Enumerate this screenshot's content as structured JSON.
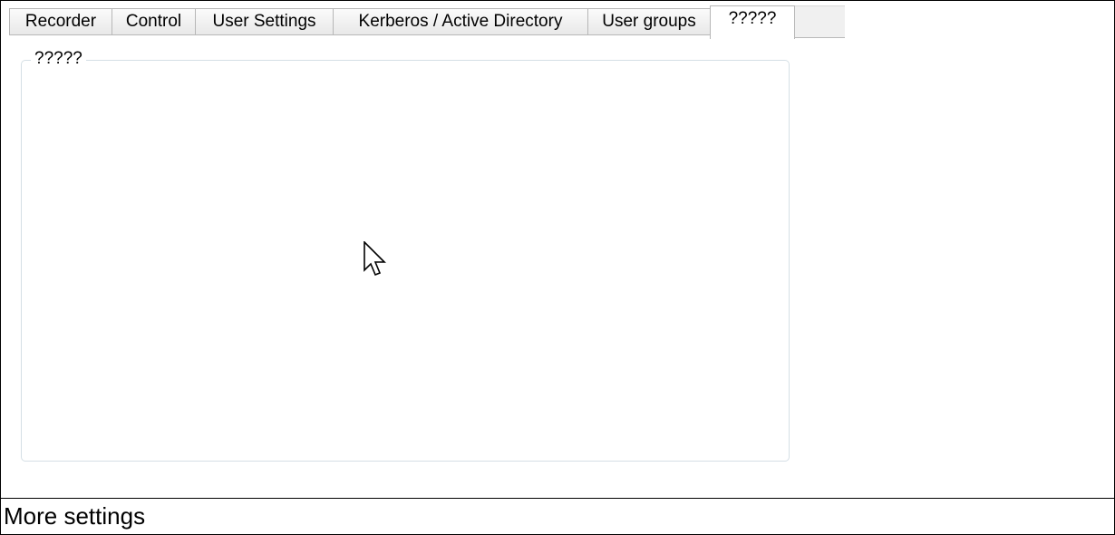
{
  "tabs": [
    {
      "label": "Recorder",
      "active": false
    },
    {
      "label": "Control",
      "active": false
    },
    {
      "label": "User Settings",
      "active": false
    },
    {
      "label": "Kerberos / Active Directory",
      "active": false
    },
    {
      "label": "User groups",
      "active": false
    },
    {
      "label": "?????",
      "active": true
    }
  ],
  "group_box": {
    "title": "?????"
  },
  "caption": {
    "text": "More settings"
  },
  "icons": {
    "pointer": "mouse-pointer-icon"
  }
}
